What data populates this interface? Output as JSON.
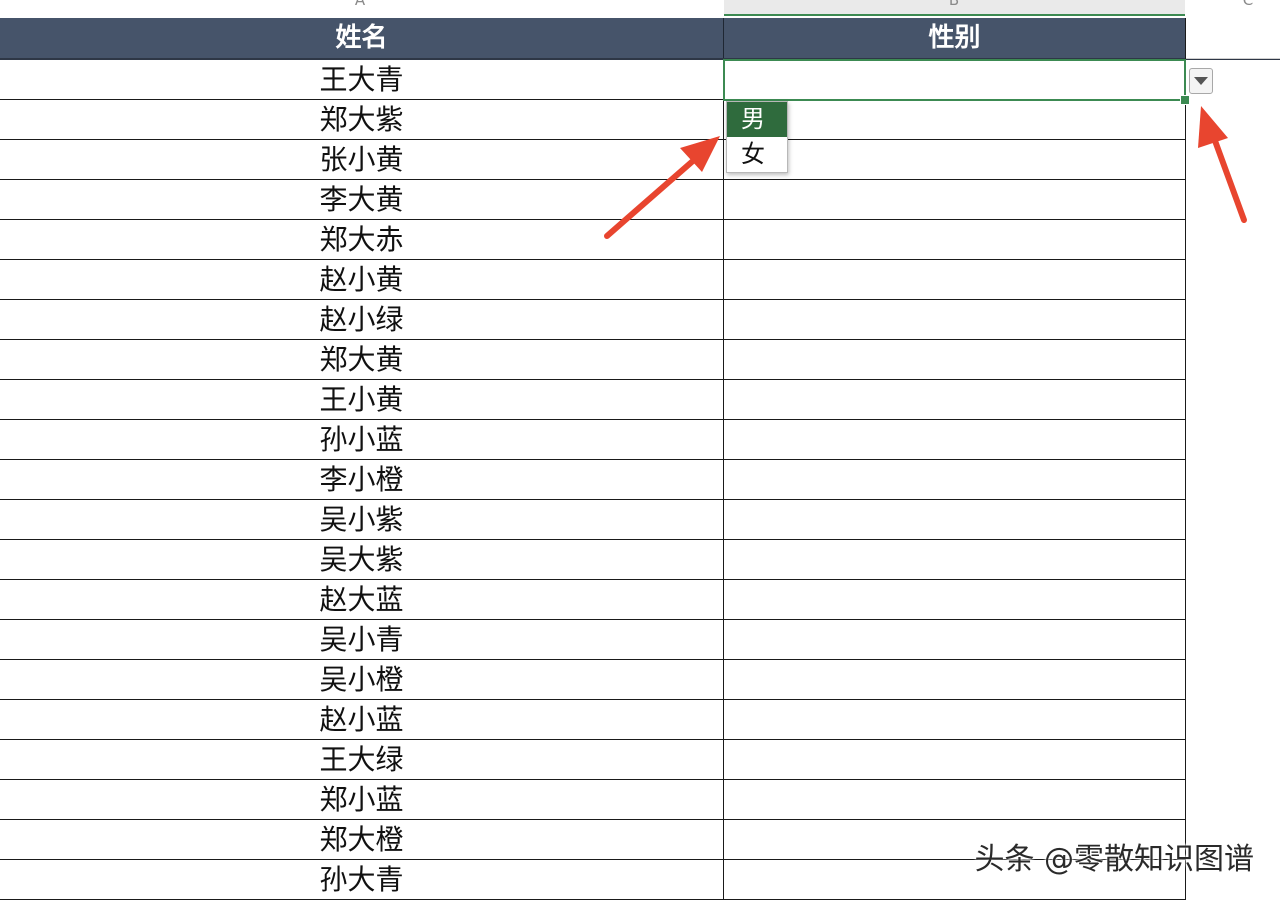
{
  "column_letters": [
    "A",
    "B",
    "C"
  ],
  "headers": {
    "name": "姓名",
    "gender": "性别"
  },
  "rows": [
    "王大青",
    "郑大紫",
    "张小黄",
    "李大黄",
    "郑大赤",
    "赵小黄",
    "赵小绿",
    "郑大黄",
    "王小黄",
    "孙小蓝",
    "李小橙",
    "吴小紫",
    "吴大紫",
    "赵大蓝",
    "吴小青",
    "吴小橙",
    "赵小蓝",
    "王大绿",
    "郑小蓝",
    "郑大橙",
    "孙大青"
  ],
  "dropdown": {
    "options": [
      "男",
      "女"
    ],
    "highlighted": "男"
  },
  "watermark": "头条 @零散知识图谱",
  "colors": {
    "header_bg": "#46546a",
    "selection_green": "#3c8a52",
    "option_highlight": "#2f6b3d",
    "annotation_arrow": "#e8452f"
  }
}
